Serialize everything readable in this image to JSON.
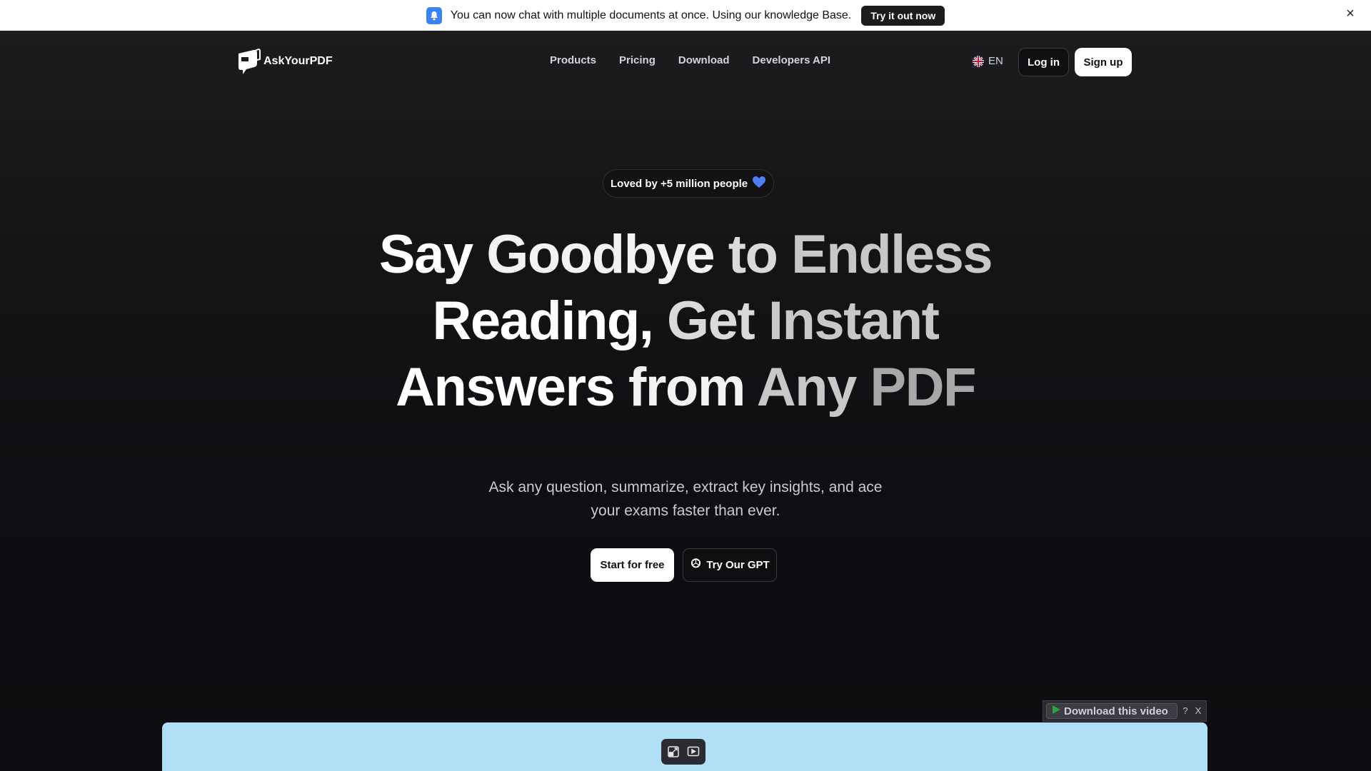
{
  "announcement": {
    "icon": "bell-icon",
    "message": "You can now chat with multiple documents at once. Using our knowledge Base.",
    "cta": "Try it out now",
    "close": "×"
  },
  "nav": {
    "brand": "AskYourPDF",
    "links": [
      "Products",
      "Pricing",
      "Download",
      "Developers API"
    ],
    "language": "EN",
    "login": "Log in",
    "signup": "Sign up"
  },
  "hero": {
    "badge": "Loved by +5 million people",
    "headline": {
      "line1": [
        "Say",
        "Goodbye",
        "to",
        "Endless"
      ],
      "line2": [
        "Reading,",
        "Get",
        "Instant"
      ],
      "line3": [
        "Answers",
        "from",
        "Any",
        "PDF"
      ]
    },
    "subtitle_line1": "Ask any question, summarize, extract key insights, and ace",
    "subtitle_line2": "your exams faster than ever.",
    "start_button": "Start for free",
    "gpt_button": "Try Our GPT"
  },
  "video_overlay": {
    "download_label": "Download this video",
    "help": "?",
    "close": "X"
  },
  "colors": {
    "accent": "#3b82f6",
    "video_bg": "#b0dff6",
    "heart": "#4f7df5"
  }
}
